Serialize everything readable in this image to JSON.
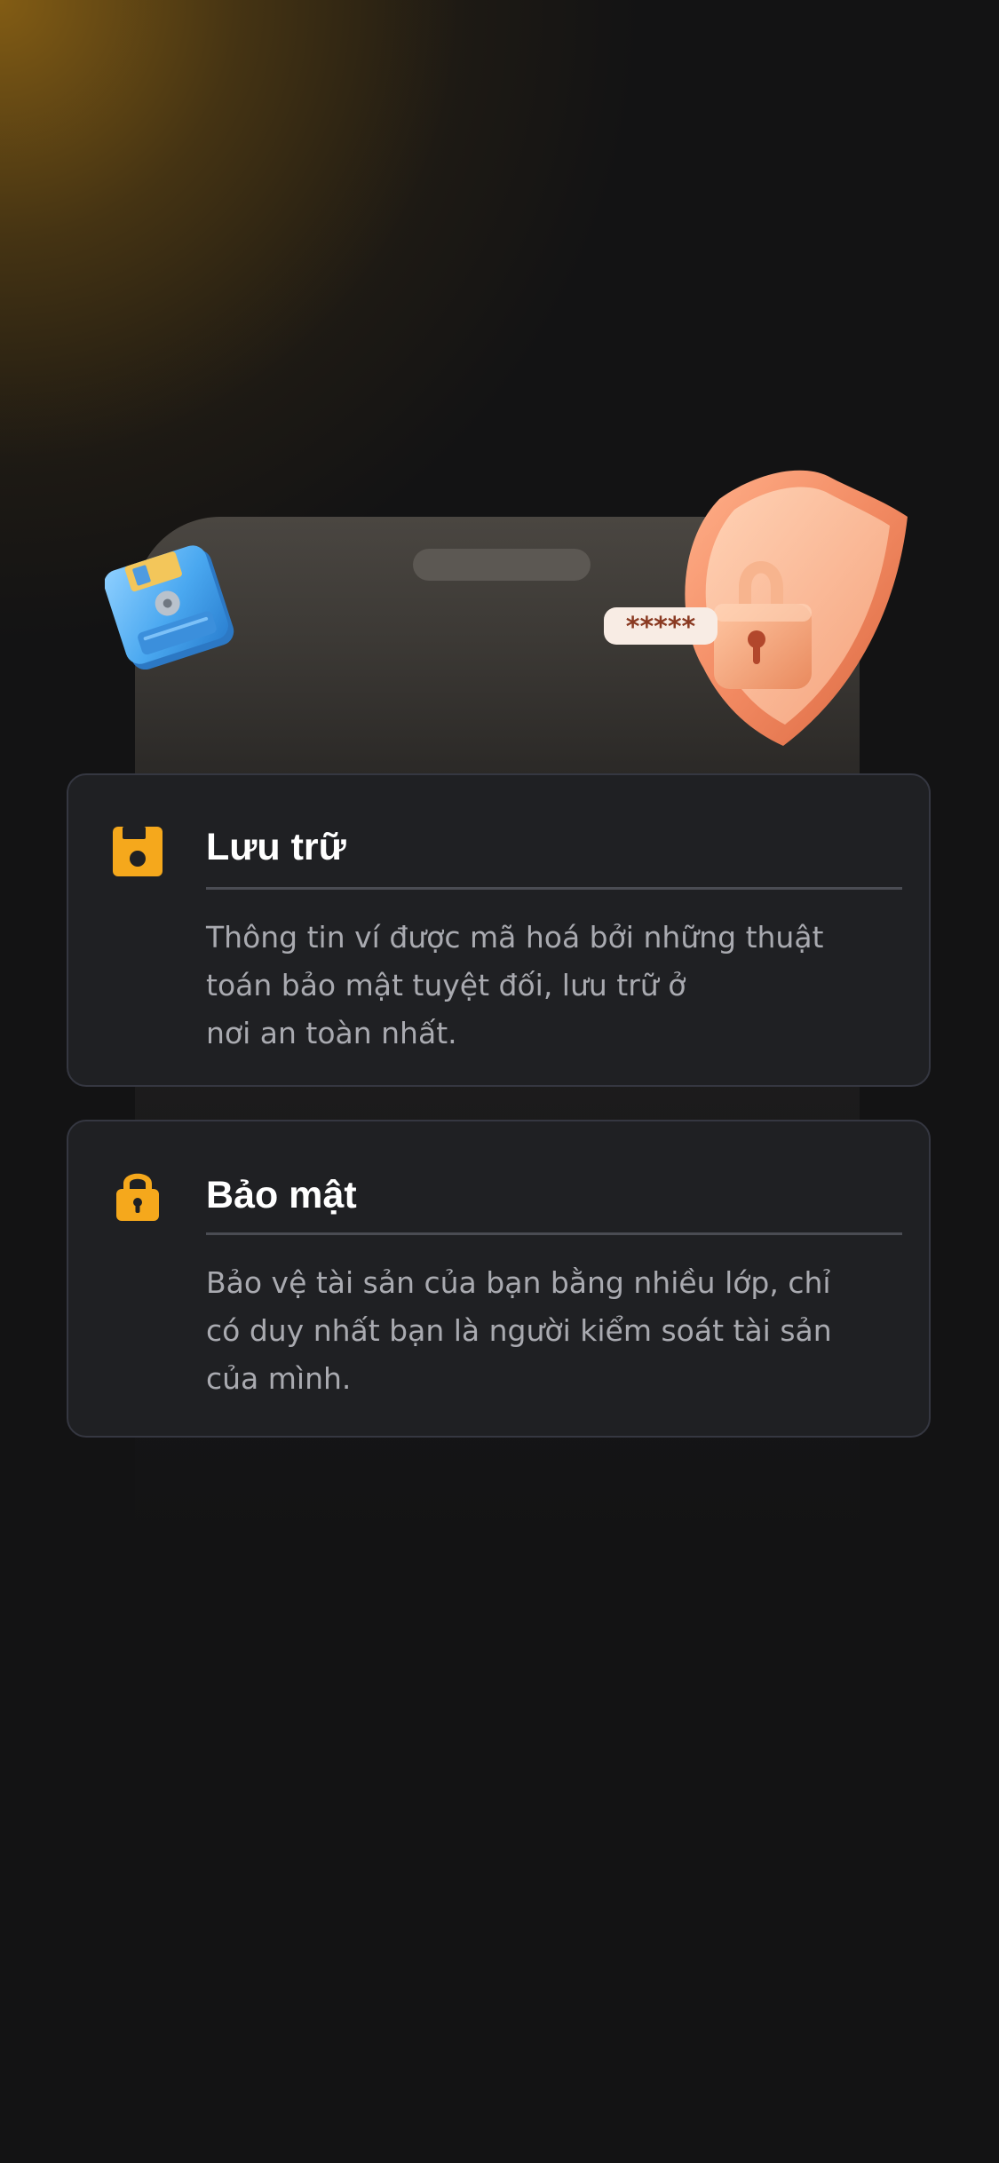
{
  "colors": {
    "background": "#131314",
    "accent": "#f5a81c",
    "card_background": "#1f2023",
    "card_border": "#353741",
    "title_text": "#ffffff",
    "body_text": "#a9aab0"
  },
  "hero": {
    "left_decoration_icon": "floppy-disk-3d-icon",
    "right_decoration_icon": "shield-padlock-password-3d-icon"
  },
  "features": [
    {
      "icon": "floppy-disk-icon",
      "title": "Lưu trữ",
      "description": "Thông tin ví được mã hoá bởi những thuật\ntoán bảo mật tuyệt đối, lưu trữ ở\nnơi an toàn nhất."
    },
    {
      "icon": "lock-icon",
      "title": "Bảo mật",
      "description": "Bảo vệ tài sản của bạn bằng nhiều lớp, chỉ\ncó duy nhất bạn là người kiểm soát tài sản\ncủa mình."
    }
  ]
}
